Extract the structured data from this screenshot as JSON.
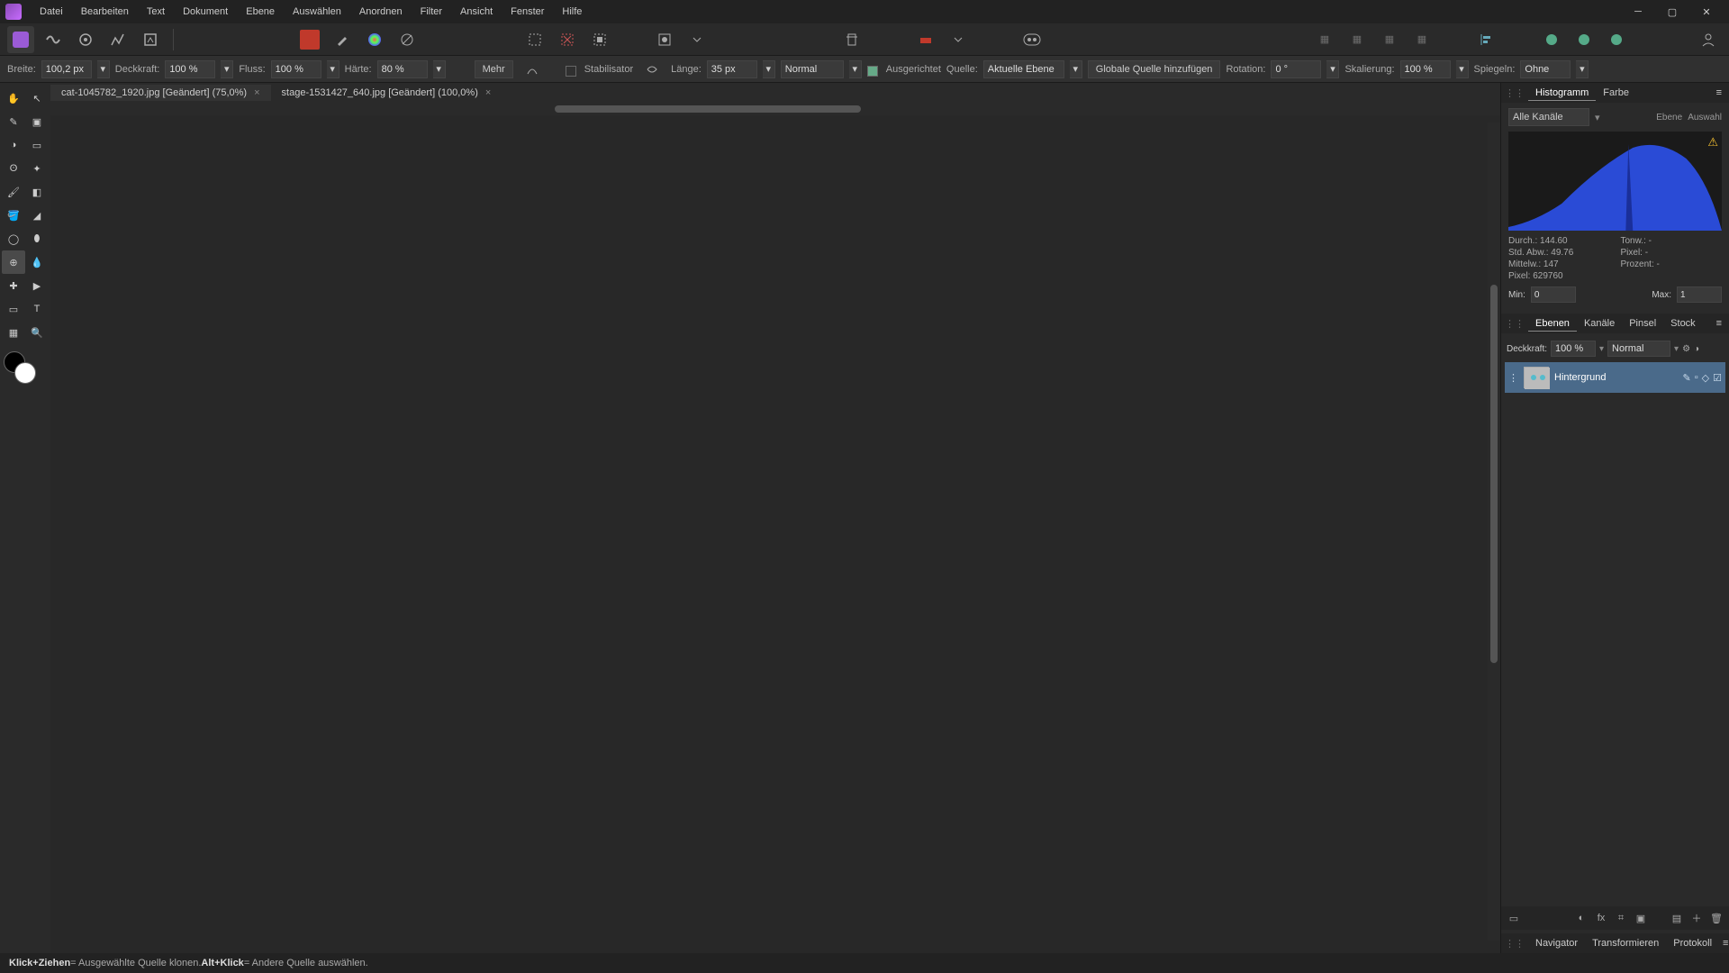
{
  "menu": {
    "items": [
      "Datei",
      "Bearbeiten",
      "Text",
      "Dokument",
      "Ebene",
      "Auswählen",
      "Anordnen",
      "Filter",
      "Ansicht",
      "Fenster",
      "Hilfe"
    ]
  },
  "docs": {
    "tab1": "cat-1045782_1920.jpg [Geändert] (75,0%)",
    "tab2": "stage-1531427_640.jpg [Geändert] (100,0%)"
  },
  "options": {
    "breite_l": "Breite:",
    "breite_v": "100,2 px",
    "deck_l": "Deckkraft:",
    "deck_v": "100 %",
    "fluss_l": "Fluss:",
    "fluss_v": "100 %",
    "haerte_l": "Härte:",
    "haerte_v": "80 %",
    "mehr": "Mehr",
    "stabil": "Stabilisator",
    "laenge_l": "Länge:",
    "laenge_v": "35 px",
    "mode_v": "Normal",
    "ausger": "Ausgerichtet",
    "quelle_l": "Quelle:",
    "quelle_v": "Aktuelle Ebene",
    "glob_q": "Globale Quelle hinzufügen",
    "rot_l": "Rotation:",
    "rot_v": "0 °",
    "skal_l": "Skalierung:",
    "skal_v": "100 %",
    "spieg_l": "Spiegeln:",
    "spieg_v": "Ohne"
  },
  "histo": {
    "tab1": "Histogramm",
    "tab2": "Farbe",
    "channel": "Alle Kanäle",
    "btn_ebene": "Ebene",
    "btn_auswahl": "Auswahl",
    "s_durch": "Durch.: 144.60",
    "s_tonw": "Tonw.: -",
    "s_std": "Std. Abw.: 49.76",
    "s_pixel": "Pixel: -",
    "s_mittel": "Mittelw.: 147",
    "s_proz": "Prozent: -",
    "s_pixcount": "Pixel: 629760",
    "min_l": "Min:",
    "min_v": "0",
    "max_l": "Max:",
    "max_v": "1"
  },
  "layers": {
    "tab1": "Ebenen",
    "tab2": "Kanäle",
    "tab3": "Pinsel",
    "tab4": "Stock",
    "deck_l": "Deckkraft:",
    "deck_v": "100 %",
    "blend": "Normal",
    "layer1": "Hintergrund"
  },
  "nav": {
    "t1": "Navigator",
    "t2": "Transformieren",
    "t3": "Protokoll"
  },
  "status": {
    "k1": "Klick+Ziehen",
    "t1": " = Ausgewählte Quelle klonen. ",
    "k2": "Alt+Klick",
    "t2": " = Andere Quelle auswählen."
  }
}
